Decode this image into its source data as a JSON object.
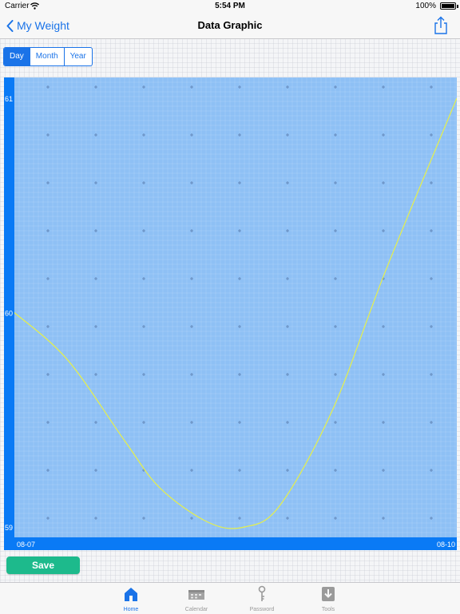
{
  "status_bar": {
    "carrier": "Carrier",
    "time": "5:54 PM",
    "battery": "100%"
  },
  "nav": {
    "back_label": "My Weight",
    "title": "Data Graphic"
  },
  "segments": [
    {
      "label": "Day",
      "active": true
    },
    {
      "label": "Month",
      "active": false
    },
    {
      "label": "Year",
      "active": false
    }
  ],
  "chart_data": {
    "type": "line",
    "ylim": [
      59,
      61
    ],
    "y_ticks": [
      "59",
      "60",
      "61"
    ],
    "x_labels": [
      "08-07",
      "08-10"
    ],
    "series": [
      {
        "values": [
          [
            0,
            60.0
          ],
          [
            0.12,
            59.78
          ],
          [
            0.25,
            59.4
          ],
          [
            0.33,
            59.18
          ],
          [
            0.44,
            59.02
          ],
          [
            0.52,
            59.0
          ],
          [
            0.6,
            59.1
          ],
          [
            0.72,
            59.55
          ],
          [
            0.84,
            60.2
          ],
          [
            1.0,
            61.0
          ]
        ]
      }
    ],
    "colors": {
      "plot_bg": "#8ec0f5",
      "axis_bar": "#0a7af5",
      "line": "#e6f04a",
      "label": "#ffffff"
    }
  },
  "save_label": "Save",
  "tabs": [
    {
      "label": "Home",
      "icon": "home-icon",
      "active": true
    },
    {
      "label": "Calendar",
      "icon": "calendar-icon",
      "active": false
    },
    {
      "label": "Password",
      "icon": "key-icon",
      "active": false
    },
    {
      "label": "Tools",
      "icon": "download-icon",
      "active": false
    }
  ]
}
